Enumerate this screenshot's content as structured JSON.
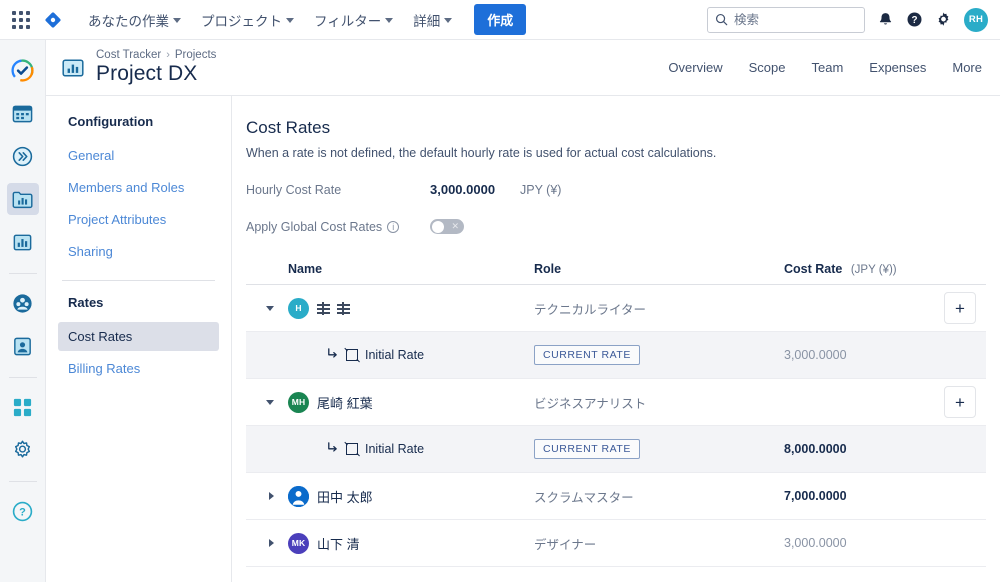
{
  "topbar": {
    "app_switcher": "app-switcher-icon",
    "brand": "brand-diamond-icon",
    "nav": [
      {
        "label": "あなたの作業"
      },
      {
        "label": "プロジェクト"
      },
      {
        "label": "フィルター"
      },
      {
        "label": "詳細"
      }
    ],
    "create_label": "作成",
    "search_placeholder": "検索",
    "search_value": "",
    "avatar_initials": "RH",
    "accent_color": "#1e6fd9",
    "avatar_color": "#2aacc8"
  },
  "rail": {
    "items": [
      {
        "icon": "jira-check-logo-icon",
        "active": false
      },
      {
        "icon": "calendar-icon",
        "active": false
      },
      {
        "icon": "chevron-double-right-icon",
        "active": false
      },
      {
        "icon": "folder-chart-icon",
        "active": true
      },
      {
        "icon": "bar-chart-icon",
        "active": false
      },
      {
        "icon": "people-group-icon",
        "active": false
      },
      {
        "icon": "person-card-icon",
        "active": false
      },
      {
        "icon": "grid-apps-icon",
        "active": false
      },
      {
        "icon": "gear-icon",
        "active": false
      },
      {
        "icon": "help-circle-icon",
        "active": false
      }
    ]
  },
  "page_header": {
    "icon": "project-chart-icon",
    "breadcrumb": {
      "root": "Cost Tracker",
      "separator": "›",
      "parent": "Projects"
    },
    "title": "Project DX",
    "tabs": [
      {
        "label": "Overview"
      },
      {
        "label": "Scope"
      },
      {
        "label": "Team"
      },
      {
        "label": "Expenses"
      },
      {
        "label": "More"
      }
    ]
  },
  "sidebar": {
    "config_title": "Configuration",
    "config_items": [
      {
        "label": "General"
      },
      {
        "label": "Members and Roles"
      },
      {
        "label": "Project Attributes"
      },
      {
        "label": "Sharing"
      }
    ],
    "rates_title": "Rates",
    "rates_items": [
      {
        "label": "Cost Rates",
        "active": true
      },
      {
        "label": "Billing Rates",
        "active": false
      }
    ]
  },
  "main": {
    "title": "Cost Rates",
    "description": "When a rate is not defined, the default hourly rate is used for actual cost calculations.",
    "hourly_label": "Hourly Cost Rate",
    "hourly_value": "3,000.0000",
    "hourly_unit": "JPY (¥)",
    "apply_global_label": "Apply Global Cost Rates",
    "apply_global_info": "info-icon",
    "apply_global_state": "off",
    "table": {
      "headers": {
        "name": "Name",
        "role": "Role",
        "rate": "Cost Rate",
        "rate_unit": "(JPY (¥))"
      },
      "add_button_label": "+",
      "rows": [
        {
          "type": "person",
          "expanded": true,
          "avatar_initials": "H",
          "avatar_color": "#2aacc8",
          "avatar_kind": "initials",
          "name": "",
          "name_unrenderable": true,
          "role": "テクニカルライター",
          "rate": "",
          "rate_style": "none",
          "has_add": true
        },
        {
          "type": "rate",
          "icon": "arrow-turn-down-right-icon",
          "glyph": "missing-glyph-box",
          "label": "Initial Rate",
          "badge": "CURRENT RATE",
          "rate": "3,000.0000",
          "rate_style": "muted"
        },
        {
          "type": "person",
          "expanded": true,
          "avatar_initials": "MH",
          "avatar_color": "#1a8552",
          "avatar_kind": "initials",
          "name": "尾崎 紅葉",
          "role": "ビジネスアナリスト",
          "rate": "",
          "rate_style": "none",
          "has_add": true
        },
        {
          "type": "rate",
          "icon": "arrow-turn-down-right-icon",
          "glyph": "missing-glyph-box",
          "label": "Initial Rate",
          "badge": "CURRENT RATE",
          "rate": "8,000.0000",
          "rate_style": "strong"
        },
        {
          "type": "person",
          "expanded": false,
          "avatar_initials": "",
          "avatar_color": "#0b6bcb",
          "avatar_kind": "person-glyph",
          "name": "田中 太郎",
          "role": "スクラムマスター",
          "rate": "7,000.0000",
          "rate_style": "strong",
          "has_add": false
        },
        {
          "type": "person",
          "expanded": false,
          "avatar_initials": "MK",
          "avatar_color": "#4b3fbb",
          "avatar_kind": "initials",
          "name": "山下 清",
          "role": "デザイナー",
          "rate": "3,000.0000",
          "rate_style": "muted",
          "has_add": false
        }
      ]
    }
  }
}
